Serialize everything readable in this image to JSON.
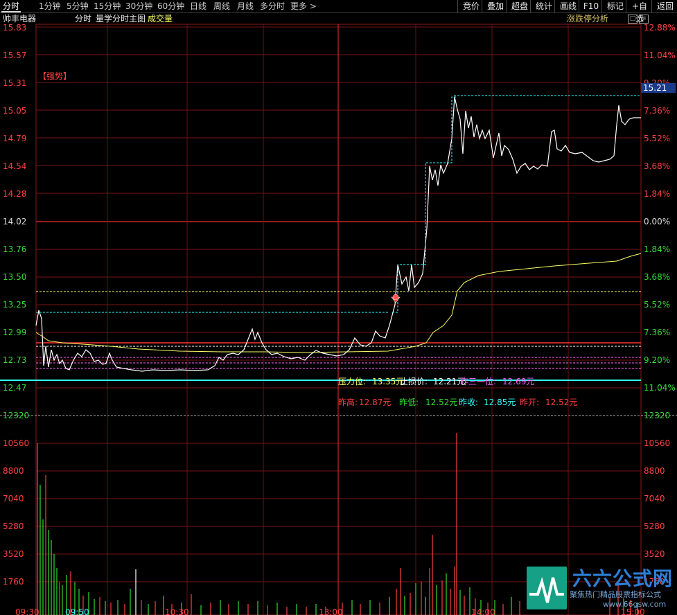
{
  "timeframe_tabs": [
    "分时",
    "1分钟",
    "5分钟",
    "15分钟",
    "30分钟",
    "60分钟",
    "日线",
    "周线",
    "月线",
    "多分时",
    "更多 >"
  ],
  "right_buttons": [
    "竞价",
    "叠加",
    "超盘",
    "统计",
    "画线",
    "F10",
    "标记",
    "+自选",
    "返回"
  ],
  "info": {
    "stock_name": "帅丰电器",
    "chart_mode": "分时",
    "indicator": "量学分时主图",
    "volume_label": "成交量",
    "analysis_label": "涨跌停分析",
    "strong_tag": "【强势】"
  },
  "price_axis_left": [
    "15.83",
    "15.57",
    "15.31",
    "15.05",
    "14.79",
    "14.54",
    "14.28",
    "14.02",
    "13.76",
    "13.50",
    "13.25",
    "12.99",
    "12.73",
    "12.47",
    "12320"
  ],
  "price_axis_right": [
    "12.88%",
    "11.04%",
    "9.20%",
    "7.36%",
    "5.52%",
    "3.68%",
    "1.84%",
    "0.00%",
    "1.84%",
    "3.68%",
    "5.52%",
    "7.36%",
    "9.20%",
    "11.04%",
    "12320"
  ],
  "current_price_tag": "15.21",
  "levels": {
    "pressure_label": "压力位:",
    "pressure_value": "13.35元",
    "stop_label": "止损价:",
    "stop_value": "12.21元",
    "third_label": "昨三一位:",
    "third_value": "12.69元",
    "prev_high_label": "昨高:",
    "prev_high_value": "12.87元",
    "prev_low_label": "昨低:",
    "prev_low_value": "12.52元",
    "prev_close_label": "昨收:",
    "prev_close_value": "12.85元",
    "prev_open_label": "昨开:",
    "prev_open_value": "12.52元"
  },
  "volume_axis": [
    "10560",
    "8800",
    "7040",
    "5280",
    "3520",
    "1760"
  ],
  "time_axis": [
    "09:30",
    "09:50",
    "10:30",
    "13:00",
    "14:00",
    "15:00"
  ],
  "watermark": {
    "brand": "六六公式网",
    "slogan": "聚焦热门精品股票指标公式",
    "url": "www.66gsw.com"
  },
  "colors": {
    "grid": "#8b1a1a",
    "price_line": "#ffffff",
    "avg_line": "#ffff66",
    "cyan": "#33ffff",
    "red_text": "#ff4040",
    "green_text": "#33dd33"
  }
}
